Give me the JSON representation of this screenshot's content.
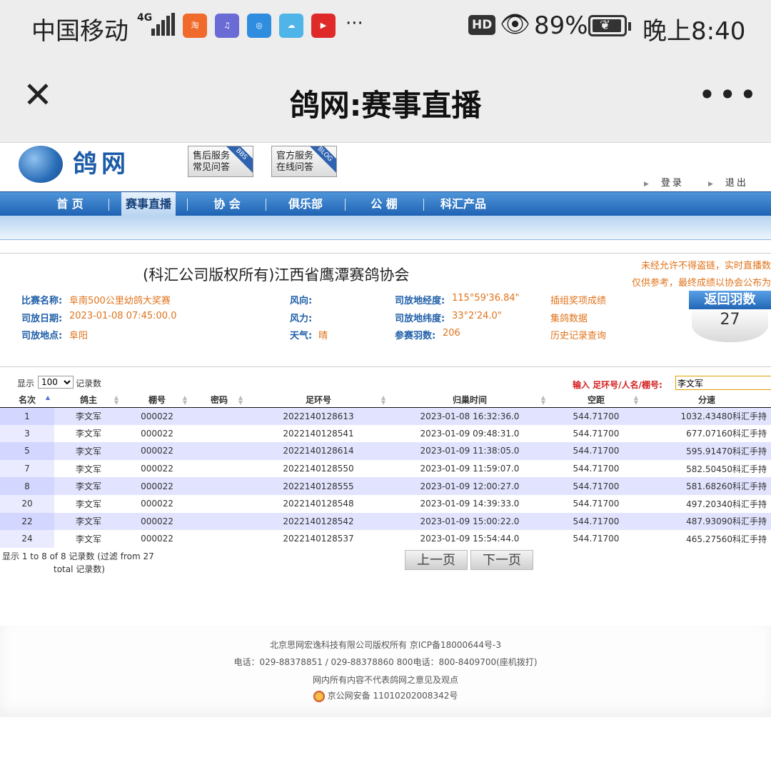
{
  "status": {
    "carrier": "中国移动",
    "network": "4G",
    "hd": "HD",
    "battery": "89%",
    "time": "晚上8:40",
    "more": "···",
    "apps": [
      {
        "name": "taobao-app-icon",
        "label": "淘",
        "color": "#f06a2b"
      },
      {
        "name": "music-app-icon",
        "label": "♫",
        "color": "#6b6bd6"
      },
      {
        "name": "browser-app-icon",
        "label": "◎",
        "color": "#2f8de0"
      },
      {
        "name": "weather-app-icon",
        "label": "☁",
        "color": "#4fb4e8"
      },
      {
        "name": "red-app-icon",
        "label": "▶",
        "color": "#e02a2a"
      }
    ]
  },
  "titlebar": {
    "title": "鸽网:赛事直播"
  },
  "site": {
    "logo": "鸽网",
    "service1": [
      "售后服务",
      "常见问答"
    ],
    "service1_tag": "BBS",
    "service2": [
      "官方服务",
      "在线问答"
    ],
    "service2_tag": "BLOG",
    "login": "登录",
    "logout": "退出"
  },
  "nav": {
    "items": [
      "首 页",
      "赛事直播",
      "协 会",
      "俱乐部",
      "公 棚",
      "科汇产品"
    ]
  },
  "race": {
    "title": "(科汇公司版权所有)江西省鹰潭赛鸽协会",
    "notice1": "未经允许不得盗链，实时直播数",
    "notice2": "仅供参考，最终成绩以协会公布为",
    "labels": {
      "name": "比赛名称:",
      "date": "司放日期:",
      "place": "司放地点:",
      "wind_dir": "风向:",
      "wind_power": "风力:",
      "weather": "天气:",
      "lon": "司放地经度:",
      "lat": "司放地纬度:",
      "count": "参赛羽数:"
    },
    "name": "阜南500公里幼鸽大奖赛",
    "date": "2023-01-08 07:45:00.0",
    "place": "阜阳",
    "wind_dir": "",
    "wind_power": "",
    "weather": "晴",
    "lon": "115°59'36.84\"",
    "lat": "33°2'24.0\"",
    "count": "206",
    "links": [
      "插组奖项成绩",
      "集鸽数据",
      "历史记录查询"
    ],
    "return_label": "返回羽数",
    "return_count": "27"
  },
  "table": {
    "show_label": "显示",
    "page_size": "100",
    "records_label": "记录数",
    "search_label": "输入 足环号/人名/棚号:",
    "search_value": "李文军",
    "headers": [
      "名次",
      "鸽主",
      "棚号",
      "密码",
      "足环号",
      "归巢时间",
      "空距",
      "分速"
    ],
    "rows": [
      [
        "1",
        "李文军",
        "000022",
        "",
        "2022140128613",
        "2023-01-08 16:32:36.0",
        "544.71700",
        "1032.43480科汇手持"
      ],
      [
        "3",
        "李文军",
        "000022",
        "",
        "2022140128541",
        "2023-01-09 09:48:31.0",
        "544.71700",
        "677.07160科汇手持"
      ],
      [
        "5",
        "李文军",
        "000022",
        "",
        "2022140128614",
        "2023-01-09 11:38:05.0",
        "544.71700",
        "595.91470科汇手持"
      ],
      [
        "7",
        "李文军",
        "000022",
        "",
        "2022140128550",
        "2023-01-09 11:59:07.0",
        "544.71700",
        "582.50450科汇手持"
      ],
      [
        "8",
        "李文军",
        "000022",
        "",
        "2022140128555",
        "2023-01-09 12:00:27.0",
        "544.71700",
        "581.68260科汇手持"
      ],
      [
        "20",
        "李文军",
        "000022",
        "",
        "2022140128548",
        "2023-01-09 14:39:33.0",
        "544.71700",
        "497.20340科汇手持"
      ],
      [
        "22",
        "李文军",
        "000022",
        "",
        "2022140128542",
        "2023-01-09 15:00:22.0",
        "544.71700",
        "487.93090科汇手持"
      ],
      [
        "24",
        "李文军",
        "000022",
        "",
        "2022140128537",
        "2023-01-09 15:54:44.0",
        "544.71700",
        "465.27560科汇手持"
      ]
    ],
    "info_line1": "显示 1 to 8 of 8 记录数 (过滤 from 27",
    "info_line2": "total 记录数)",
    "prev": "上一页",
    "next": "下一页"
  },
  "footer": {
    "line1": "北京思网宏逸科技有限公司版权所有 京ICP备18000644号-3",
    "line2": "电话：029-88378851 / 029-88378860   800电话：800-8409700(座机拨打)",
    "line3": "网内所有内容不代表鸽网之意见及观点",
    "line4": "京公网安备 11010202008342号"
  }
}
